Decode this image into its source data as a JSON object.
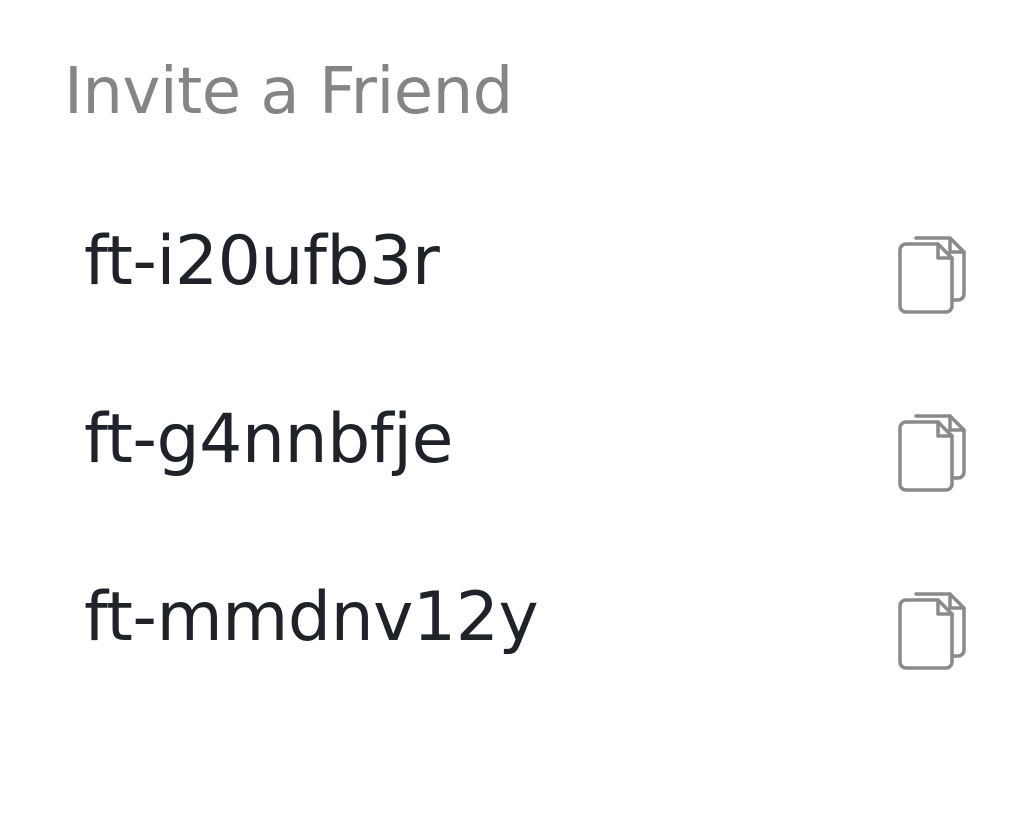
{
  "invite": {
    "title": "Invite a Friend",
    "codes": [
      {
        "code": "ft-i20ufb3r",
        "action_icon": "copy-icon"
      },
      {
        "code": "ft-g4nnbfje",
        "action_icon": "copy-icon"
      },
      {
        "code": "ft-mmdnv12y",
        "action_icon": "copy-icon"
      }
    ]
  },
  "colors": {
    "heading": "#858585",
    "code_text": "#1f2329",
    "icon_stroke": "#8a8a8a",
    "background": "#ffffff"
  }
}
